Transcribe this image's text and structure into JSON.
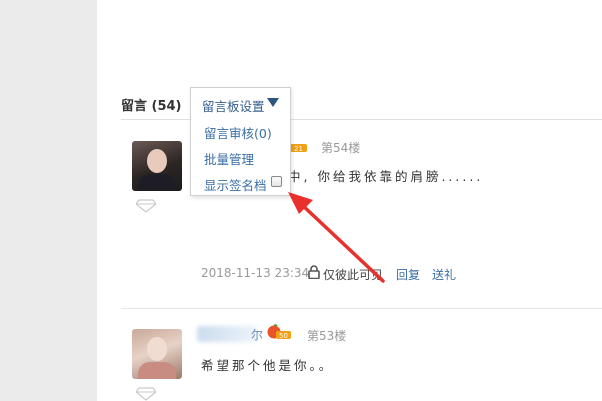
{
  "section": {
    "title": "留言 (54)"
  },
  "dropdown": {
    "header": "留言板设置",
    "items": [
      "留言审核(0)",
      "批量管理",
      "显示签名档"
    ],
    "checkbox_checked": false
  },
  "entries": [
    {
      "floor": "第54楼",
      "level": "21",
      "content_visible": "中, 你给我依靠的肩膀......",
      "time": "2018-11-13 23:34",
      "privacy": "仅彼此可见",
      "actions": [
        "回复",
        "送礼"
      ]
    },
    {
      "name_tail": "尔",
      "floor": "第53楼",
      "level": "50",
      "content": "希望那个他是你。。"
    }
  ],
  "colors": {
    "link": "#3a6ea5",
    "gutter": "#ebebeb",
    "arrow": "#e8302c"
  }
}
